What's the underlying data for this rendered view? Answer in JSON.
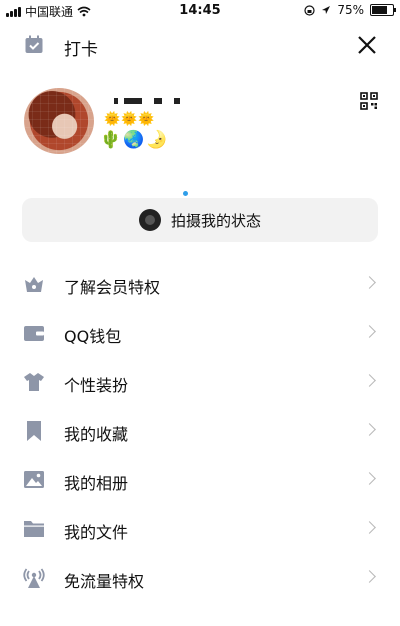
{
  "status_bar": {
    "carrier": "中国联通",
    "time": "14:45",
    "battery_percent": "75%",
    "battery_level": 0.75
  },
  "header": {
    "title": "打卡"
  },
  "profile": {
    "level_icons": "🌞🌞🌞",
    "badges": "🌵🌏🌛"
  },
  "capture": {
    "label": "拍摄我的状态"
  },
  "menu": {
    "items": [
      {
        "label": "了解会员特权",
        "icon": "vip-crown-icon"
      },
      {
        "label": "QQ钱包",
        "icon": "wallet-icon"
      },
      {
        "label": "个性装扮",
        "icon": "shirt-icon"
      },
      {
        "label": "我的收藏",
        "icon": "bookmark-icon"
      },
      {
        "label": "我的相册",
        "icon": "image-icon"
      },
      {
        "label": "我的文件",
        "icon": "folder-icon"
      },
      {
        "label": "免流量特权",
        "icon": "antenna-icon"
      }
    ]
  },
  "colors": {
    "icon": "#8e96a8",
    "accent": "#2f9ee9",
    "capture_bg": "#f2f2f2"
  }
}
